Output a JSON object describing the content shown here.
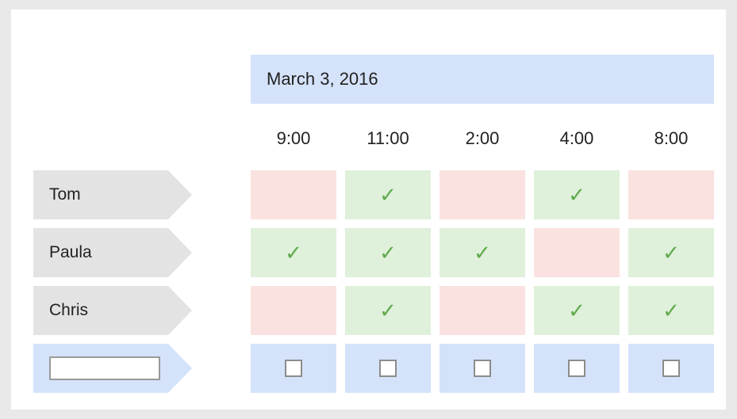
{
  "date_label": "March 3, 2016",
  "times": [
    "9:00",
    "11:00",
    "2:00",
    "4:00",
    "8:00"
  ],
  "participants": [
    {
      "name": "Tom",
      "availability": [
        false,
        true,
        false,
        true,
        false
      ]
    },
    {
      "name": "Paula",
      "availability": [
        true,
        true,
        true,
        false,
        true
      ]
    },
    {
      "name": "Chris",
      "availability": [
        false,
        true,
        false,
        true,
        true
      ]
    }
  ],
  "new_entry": {
    "name_value": "",
    "name_placeholder": "",
    "checked": [
      false,
      false,
      false,
      false,
      false
    ]
  },
  "check_glyph": "✓",
  "colors": {
    "available": "#dff0db",
    "unavailable": "#f9e2e0",
    "header": "#d4e3fa",
    "name_tag": "#e3e3e3",
    "check": "#5faa4b"
  }
}
